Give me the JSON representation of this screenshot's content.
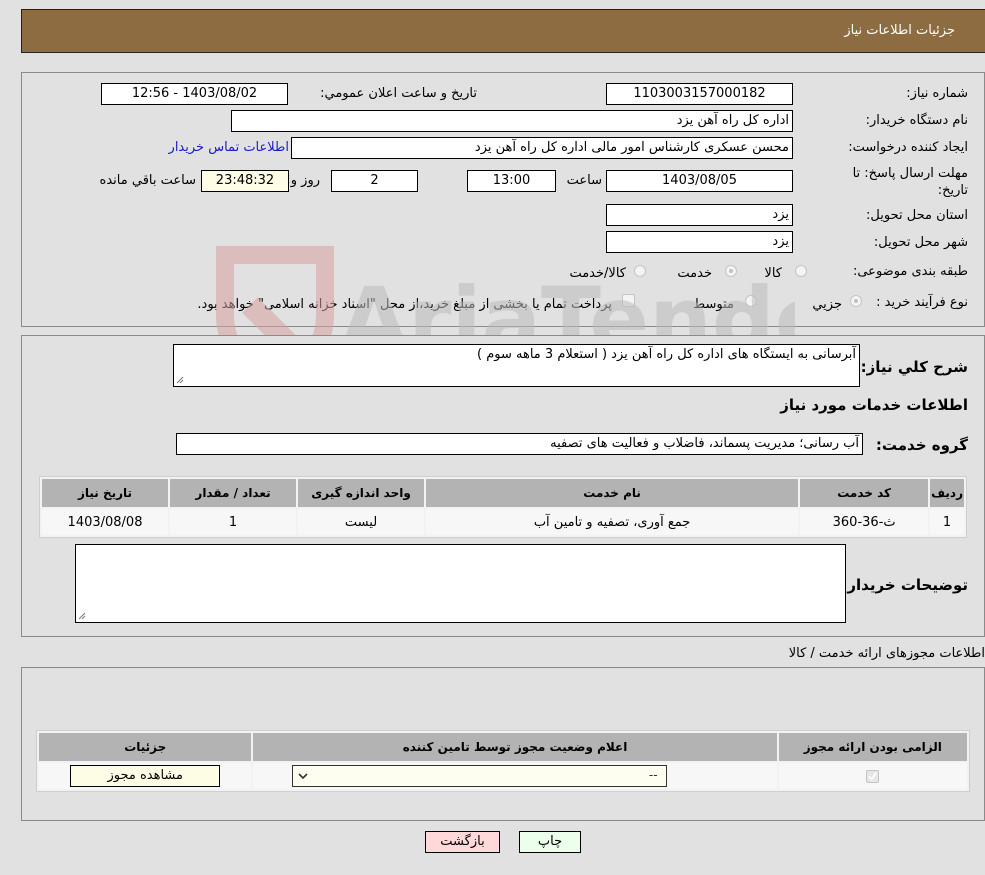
{
  "header": {
    "title": "جزئیات اطلاعات نیاز"
  },
  "info": {
    "need_number_label": "شماره نیاز:",
    "need_number": "1103003157000182",
    "announce_label": "تاریخ و ساعت اعلان عمومي:",
    "announce_value": "1403/08/02 - 12:56",
    "buyer_org_label": "نام دستگاه خریدار:",
    "buyer_org": "اداره کل راه آهن یزد",
    "creator_label": "ایجاد کننده درخواست:",
    "creator": "محسن عسکری کارشناس امور مالی اداره کل راه آهن یزد",
    "contact_link": "اطلاعات تماس خریدار",
    "deadline_label_line1": "مهلت ارسال پاسخ: تا",
    "deadline_label_line2": "تاریخ:",
    "deadline_date": "1403/08/05",
    "time_label": "ساعت",
    "deadline_time": "13:00",
    "days_value": "2",
    "days_label": "روز و",
    "remaining_time": "23:48:32",
    "remaining_label": "ساعت باقي مانده",
    "province_label": "استان محل تحویل:",
    "province": "یزد",
    "city_label": "شهر محل تحویل:",
    "city": "یزد",
    "category_label": "طبقه بندی موضوعی:",
    "category_options": [
      {
        "label": "کالا",
        "checked": false
      },
      {
        "label": "خدمت",
        "checked": true
      },
      {
        "label": "کالا/خدمت",
        "checked": false
      }
    ],
    "process_label": "نوع فرآیند خرید :",
    "process_options": [
      {
        "label": "جزیي",
        "checked": true
      },
      {
        "label": "متوسط",
        "checked": false
      }
    ],
    "payment_note": "پرداخت تمام یا بخشی از مبلغ خرید،از محل \"اسناد خزانه اسلامی\" خواهد بود.",
    "payment_checked": false
  },
  "details": {
    "description_label": "شرح کلي نیاز:",
    "description": "آبرسانی به ایستگاه های اداره کل راه آهن یزد ( استعلام 3 ماهه سوم )",
    "services_heading": "اطلاعات خدمات مورد نیاز",
    "service_group_label": "گروه خدمت:",
    "service_group": "آب رسانی؛ مدیریت پسماند، فاضلاب و فعالیت های تصفیه",
    "table": {
      "headers": [
        "ردیف",
        "کد خدمت",
        "نام خدمت",
        "واحد اندازه گیری",
        "تعداد / مقدار",
        "تاریخ نیاز"
      ],
      "rows": [
        [
          "1",
          "ث-36-360",
          "جمع آوری، تصفیه و تامین آب",
          "لیست",
          "1",
          "1403/08/08"
        ]
      ]
    },
    "buyer_notes_label": "توضیحات خریدار:",
    "buyer_notes": ""
  },
  "permits": {
    "title": "اطلاعات مجوزهای ارائه خدمت / کالا",
    "headers": [
      "الزامی بودن ارائه مجوز",
      "اعلام وضعیت مجوز توسط تامین کننده",
      "جزئیات"
    ],
    "row": {
      "required": true,
      "status_value": "--",
      "details_button": "مشاهده مجوز"
    }
  },
  "buttons": {
    "print": "چاپ",
    "back": "بازگشت"
  },
  "watermark": "AriaTender.neT"
}
